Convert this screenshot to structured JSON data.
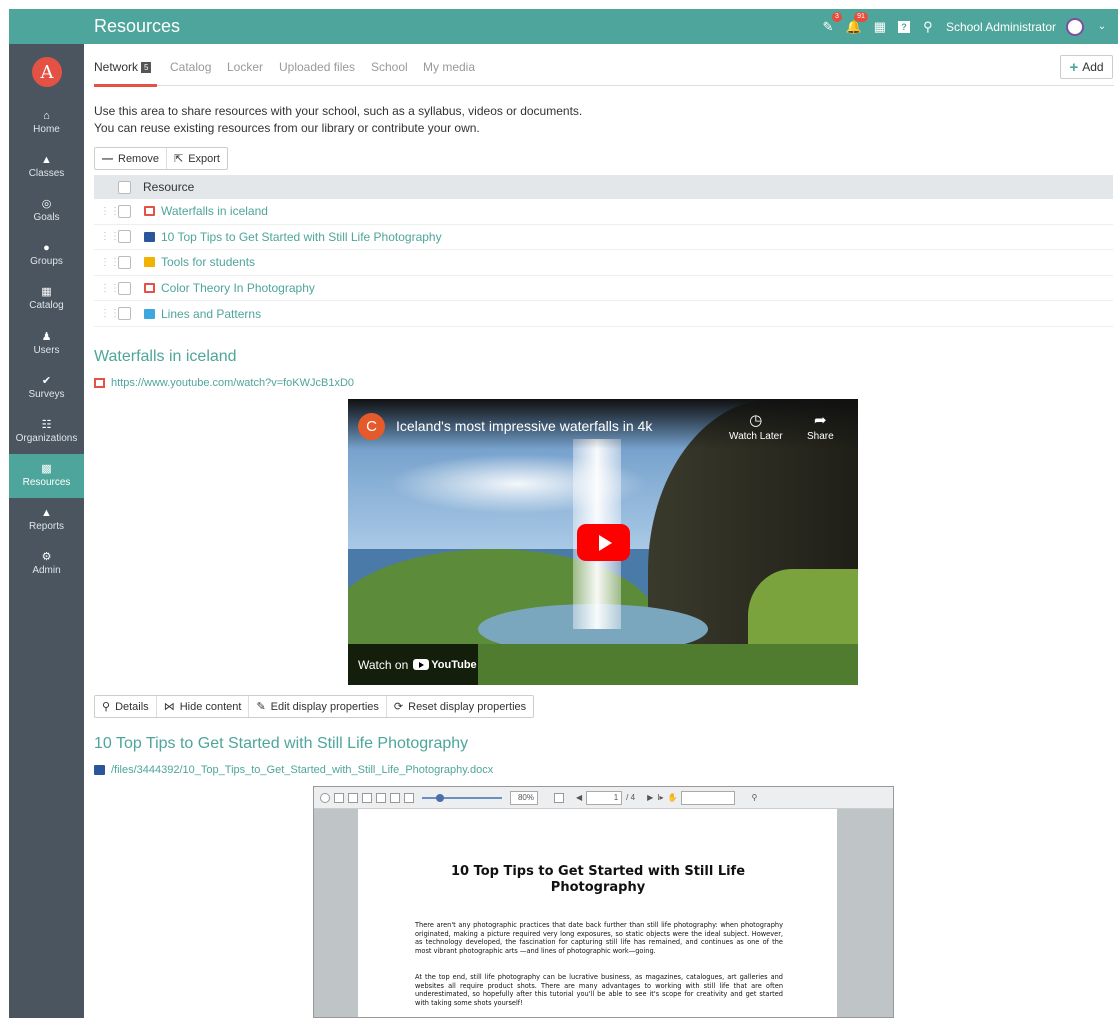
{
  "header": {
    "title": "Resources",
    "notification_badge_1": "3",
    "notification_badge_2": "91",
    "user_name": "School Administrator"
  },
  "sidebar": {
    "logo": "A",
    "items": [
      {
        "label": "Home",
        "icon": "home-icon"
      },
      {
        "label": "Classes",
        "icon": "classes-icon"
      },
      {
        "label": "Goals",
        "icon": "goals-icon"
      },
      {
        "label": "Groups",
        "icon": "groups-icon"
      },
      {
        "label": "Catalog",
        "icon": "catalog-icon"
      },
      {
        "label": "Users",
        "icon": "users-icon"
      },
      {
        "label": "Surveys",
        "icon": "surveys-icon"
      },
      {
        "label": "Organizations",
        "icon": "organizations-icon"
      },
      {
        "label": "Resources",
        "icon": "resources-icon",
        "active": true
      },
      {
        "label": "Reports",
        "icon": "reports-icon"
      },
      {
        "label": "Admin",
        "icon": "admin-icon"
      }
    ]
  },
  "tabs": {
    "network": "Network",
    "network_badge": "5",
    "catalog": "Catalog",
    "locker": "Locker",
    "uploaded_files": "Uploaded files",
    "school": "School",
    "my_media": "My media"
  },
  "add_label": "Add",
  "intro": {
    "line1": "Use this area to share resources with your school, such as a syllabus, videos or documents.",
    "line2": "You can reuse existing resources from our library or contribute your own."
  },
  "toolbar": {
    "remove": "Remove",
    "export": "Export"
  },
  "table": {
    "header": "Resource",
    "rows": [
      {
        "name": "Waterfalls in iceland",
        "icon": "video-icon",
        "color": "#e45245"
      },
      {
        "name": "10 Top Tips to Get Started with Still Life Photography",
        "icon": "word-doc-icon",
        "color": "#2b579a"
      },
      {
        "name": "Tools for students",
        "icon": "folder-icon",
        "color": "#f0b400"
      },
      {
        "name": "Color Theory In Photography",
        "icon": "video-icon",
        "color": "#e45245"
      },
      {
        "name": "Lines and Patterns",
        "icon": "doc-icon",
        "color": "#3da8e0"
      }
    ]
  },
  "section1": {
    "title": "Waterfalls in iceland",
    "url": "https://www.youtube.com/watch?v=foKWJcB1xD0"
  },
  "video": {
    "channel_initial": "C",
    "title": "Iceland's most impressive waterfalls in 4k",
    "watch_later": "Watch Later",
    "share": "Share",
    "watch_on": "Watch on",
    "youtube": "YouTube"
  },
  "actions": {
    "details": "Details",
    "hide_content": "Hide content",
    "edit_display": "Edit display properties",
    "reset_display": "Reset display properties"
  },
  "section2": {
    "title": "10 Top Tips to Get Started with Still Life Photography",
    "path": "/files/3444392/10_Top_Tips_to_Get_Started_with_Still_Life_Photography.docx"
  },
  "viewer": {
    "zoom": "80%",
    "page": "1",
    "page_total": "/ 4",
    "doc_title": "10 Top Tips to Get Started with Still Life Photography",
    "para1": "There aren't any photographic practices that date back further than still life photography: when photography originated, making a picture required very long exposures, so static objects were the ideal subject. However, as technology developed, the fascination for capturing still life has remained, and continues as one of the most vibrant photographic arts —and lines of photographic work—going.",
    "para2": "At the top end, still life photography can be lucrative business, as magazines, catalogues, art galleries and websites all require product shots. There are many advantages to working with still life that are often underestimated, so hopefully after this tutorial you'll be able to see it's scope for creativity and get started with taking some shots yourself!"
  },
  "colors": {
    "accent": "#4ea59b",
    "sidebar": "#4a5560",
    "tab_active": "#e45245"
  }
}
